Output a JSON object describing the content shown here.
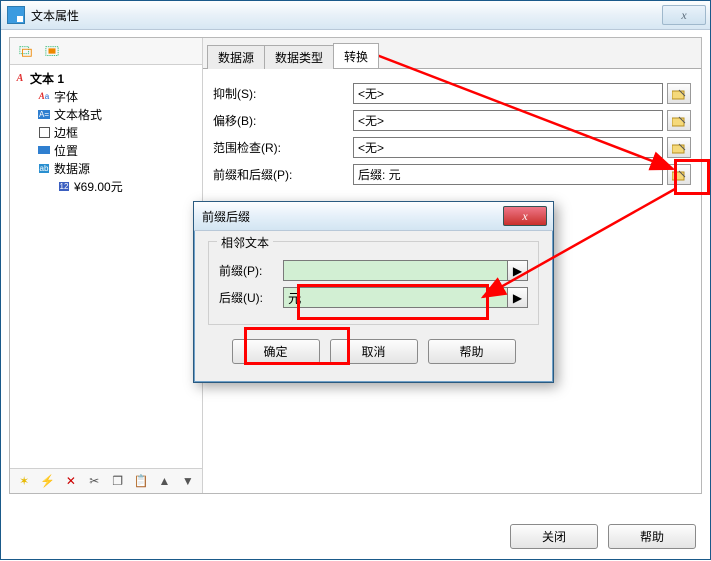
{
  "window": {
    "title": "文本属性",
    "close_glyph": "x"
  },
  "tree": {
    "root": "文本 1",
    "items": [
      "字体",
      "文本格式",
      "边框",
      "位置",
      "数据源"
    ],
    "leaf": "¥69.00元"
  },
  "tabs": {
    "t0": "数据源",
    "t1": "数据类型",
    "t2": "转换"
  },
  "form": {
    "suppress": {
      "label": "抑制(S):",
      "value": "<无>"
    },
    "offset": {
      "label": "偏移(B):",
      "value": "<无>"
    },
    "range": {
      "label": "范围检查(R):",
      "value": "<无>"
    },
    "affix": {
      "label": "前缀和后缀(P):",
      "value": "后缀: 元"
    }
  },
  "dialog": {
    "title": "前缀后缀",
    "group": "相邻文本",
    "prefix": {
      "label": "前缀(P):",
      "value": ""
    },
    "suffix": {
      "label": "后缀(U):",
      "value": "元"
    },
    "ok": "确定",
    "cancel": "取消",
    "help": "帮助"
  },
  "footer": {
    "close": "关闭",
    "help": "帮助"
  },
  "icons": {
    "play": "▶",
    "wand": "✶",
    "del": "✕",
    "cut": "✂",
    "copy": "❐",
    "paste": "📋",
    "up": "▲",
    "down": "▼",
    "sel1": "⬚",
    "sel2": "⧉"
  }
}
